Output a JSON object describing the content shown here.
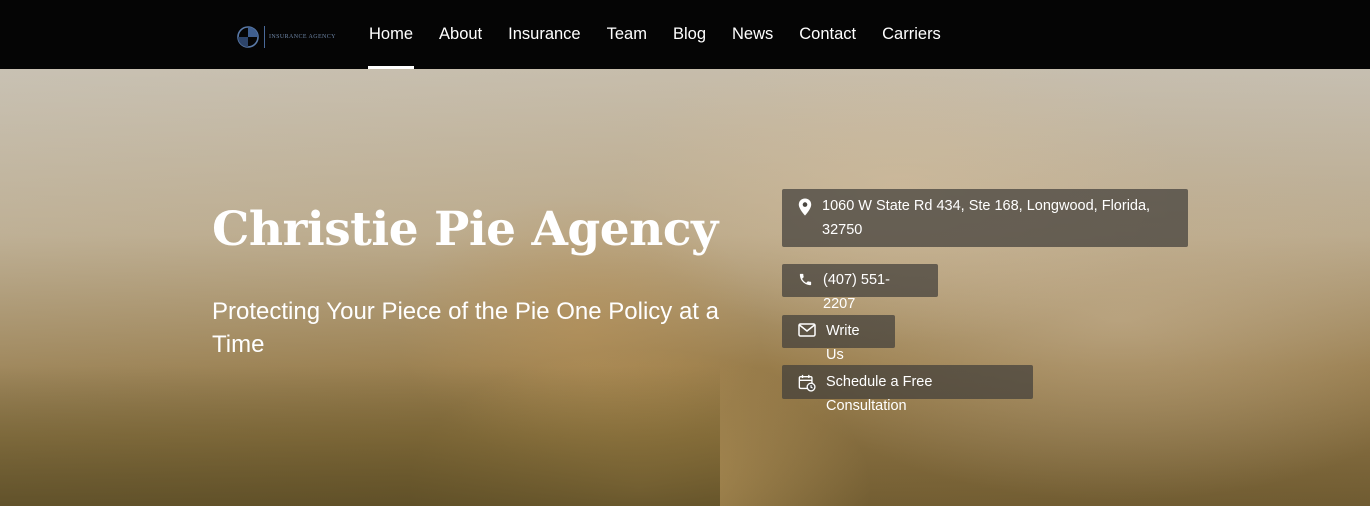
{
  "nav": {
    "logo_text": "INSURANCE AGENCY",
    "items": [
      {
        "label": "Home",
        "active": true
      },
      {
        "label": "About"
      },
      {
        "label": "Insurance"
      },
      {
        "label": "Team"
      },
      {
        "label": "Blog"
      },
      {
        "label": "News"
      },
      {
        "label": "Contact"
      },
      {
        "label": "Carriers"
      }
    ]
  },
  "hero": {
    "title": "Christie Pie Agency",
    "subtitle": "Protecting Your Piece of the Pie One Policy at a Time"
  },
  "contact": {
    "address": "1060 W State Rd 434, Ste 168, Longwood, Florida, 32750",
    "phone": "(407) 551-2207",
    "write": "Write Us",
    "schedule": "Schedule a Free Consultation"
  },
  "icons": {
    "address": "map-pin-icon",
    "phone": "phone-icon",
    "write": "envelope-icon",
    "schedule": "calendar-clock-icon"
  },
  "colors": {
    "nav_bg": "#050505",
    "text": "#ffffff",
    "pill_bg": "rgba(65,62,58,0.72)"
  }
}
